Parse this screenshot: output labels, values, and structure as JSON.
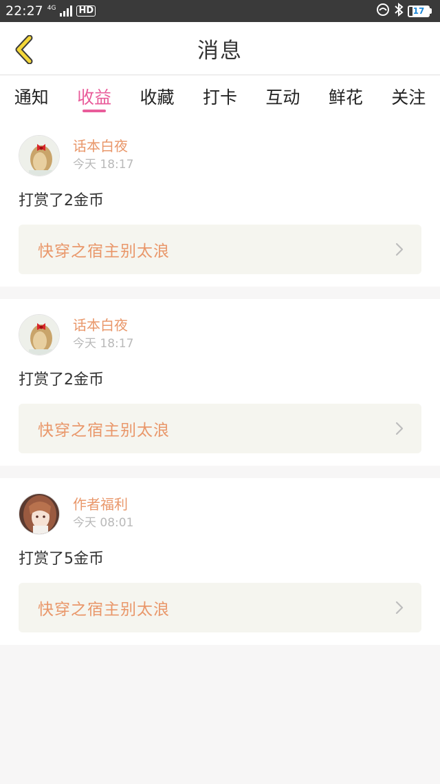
{
  "status_bar": {
    "time": "22:27",
    "network": "4G",
    "hd": "HD",
    "battery": "17",
    "battery_level": 0.17
  },
  "header": {
    "title": "消息"
  },
  "tabs": [
    {
      "label": "通知",
      "active": false
    },
    {
      "label": "收益",
      "active": true
    },
    {
      "label": "收藏",
      "active": false
    },
    {
      "label": "打卡",
      "active": false
    },
    {
      "label": "互动",
      "active": false
    },
    {
      "label": "鲜花",
      "active": false
    },
    {
      "label": "关注",
      "active": false
    }
  ],
  "messages": [
    {
      "user": "话本白夜",
      "time": "今天 18:17",
      "text": "打赏了2金币",
      "book": "快穿之宿主别太浪"
    },
    {
      "user": "话本白夜",
      "time": "今天 18:17",
      "text": "打赏了2金币",
      "book": "快穿之宿主别太浪"
    },
    {
      "user": "作者福利",
      "time": "今天 08:01",
      "text": "打赏了5金币",
      "book": "快穿之宿主别太浪"
    }
  ],
  "colors": {
    "accent_pink": "#e95c9a",
    "name_orange": "#e9976a",
    "back_arrow_yellow": "#f4d73a"
  }
}
